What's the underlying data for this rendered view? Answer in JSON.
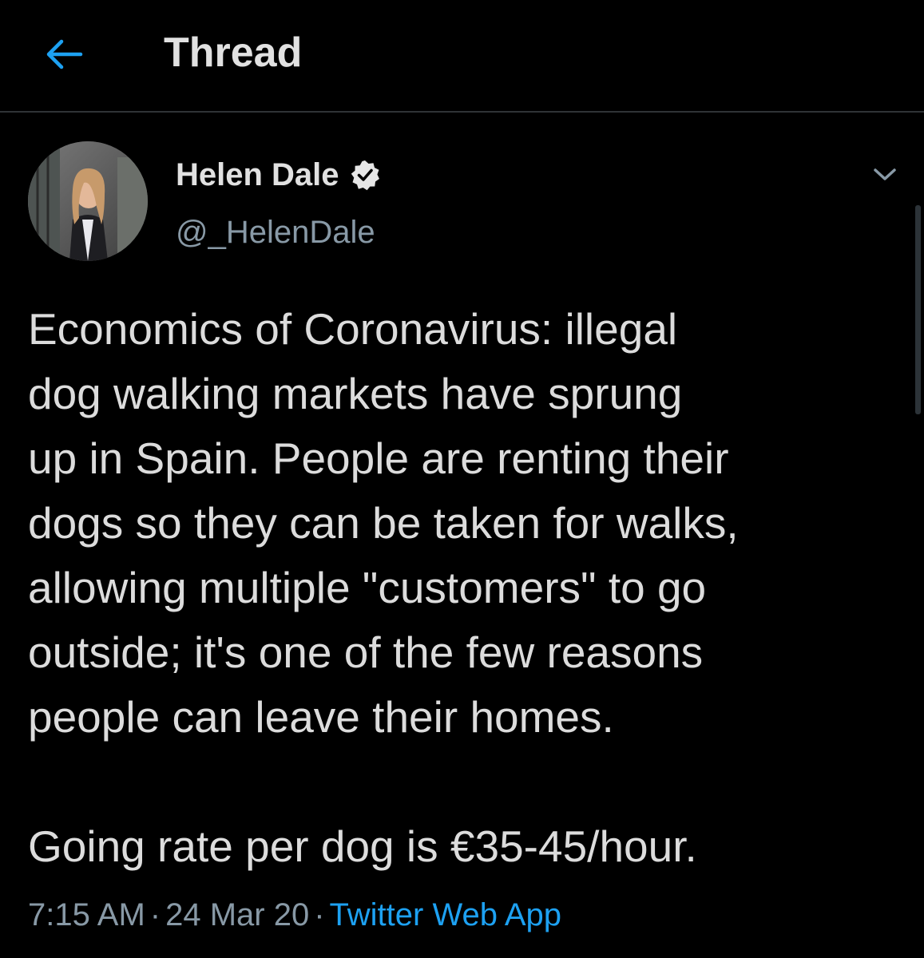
{
  "header": {
    "title": "Thread",
    "back_icon": "arrow-left-icon",
    "accent_color": "#1da1f2"
  },
  "tweet": {
    "author": {
      "name": "Helen Dale",
      "handle": "@_HelenDale",
      "verified": true,
      "verified_icon": "verified-badge-icon"
    },
    "menu_icon": "chevron-down-icon",
    "text": "Economics of Coronavirus: illegal\ndog walking markets have sprung\nup in Spain. People are renting their\ndogs so they can be taken for walks,\nallowing multiple \"customers\" to go\noutside; it's one of the few reasons\npeople can leave their homes.\n\nGoing rate per dog is €35-45/hour.",
    "time": "7:15 AM",
    "separator": "·",
    "date": "24 Mar 20",
    "source": "Twitter Web App"
  }
}
